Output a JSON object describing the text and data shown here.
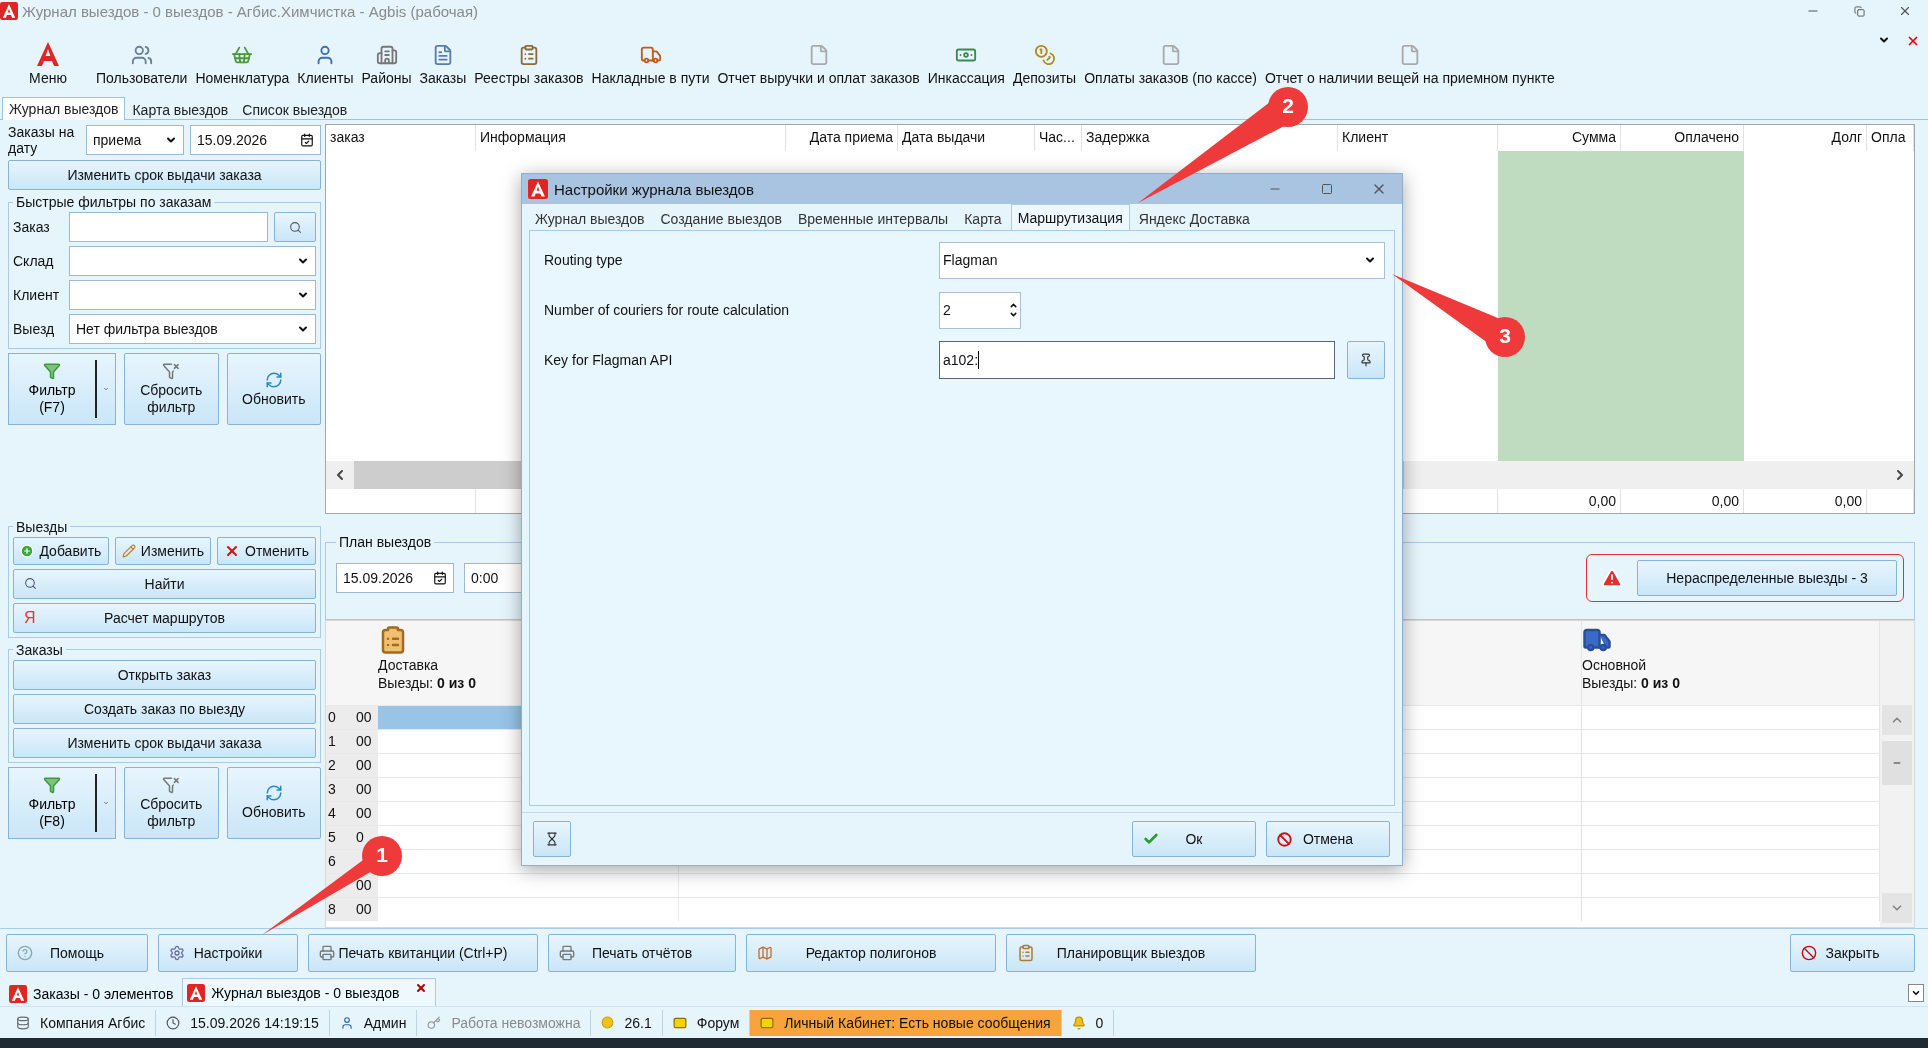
{
  "window": {
    "title": "Журнал выездов - 0 выездов - Агбис.Химчистка - Agbis (рабочая)"
  },
  "toolbar": {
    "menu_label": "Меню",
    "items": [
      {
        "label": "Пользователи"
      },
      {
        "label": "Номенклатура"
      },
      {
        "label": "Клиенты"
      },
      {
        "label": "Районы"
      },
      {
        "label": "Заказы"
      },
      {
        "label": "Реестры заказов"
      },
      {
        "label": "Накладные в пути"
      },
      {
        "label": "Отчет выручки и оплат заказов"
      },
      {
        "label": "Инкассация"
      },
      {
        "label": "Депозиты"
      },
      {
        "label": "Оплаты заказов (по кассе)"
      },
      {
        "label": "Отчет о наличии вещей на приемном пункте"
      }
    ]
  },
  "view_tabs": [
    {
      "label": "Журнал выездов",
      "selected": true
    },
    {
      "label": "Карта выездов",
      "selected": false
    },
    {
      "label": "Список выездов",
      "selected": false
    }
  ],
  "left_panel": {
    "date_filter": {
      "label": "Заказы на дату",
      "mode": "приема",
      "date": "15.09.2026"
    },
    "change_due_button": "Изменить срок выдачи заказа",
    "quick_filters": {
      "title": "Быстрые фильтры по заказам",
      "fields": [
        {
          "label": "Заказ",
          "kind": "search"
        },
        {
          "label": "Склад",
          "kind": "select"
        },
        {
          "label": "Клиент",
          "kind": "select"
        },
        {
          "label": "Выезд",
          "kind": "select",
          "value": "Нет фильтра выездов"
        }
      ]
    },
    "filter_buttons": [
      {
        "label": "Фильтр (F7)",
        "kind": "filter"
      },
      {
        "label": "Сбросить фильтр",
        "kind": "reset"
      },
      {
        "label": "Обновить",
        "kind": "refresh"
      }
    ],
    "trips": {
      "title": "Выезды",
      "actions": [
        {
          "label": "Добавить",
          "kind": "add"
        },
        {
          "label": "Изменить",
          "kind": "edit"
        },
        {
          "label": "Отменить",
          "kind": "cancel"
        }
      ],
      "find_button": "Найти",
      "route_button": {
        "icon": "Я",
        "label": "Расчет маршрутов"
      }
    },
    "orders": {
      "title": "Заказы",
      "buttons": [
        "Открыть заказ",
        "Создать заказ по выезду",
        "Изменить срок выдачи заказа"
      ]
    },
    "filter_buttons_2": [
      {
        "label": "Фильтр (F8)",
        "kind": "filter"
      },
      {
        "label": "Сбросить фильтр",
        "kind": "reset"
      },
      {
        "label": "Обновить",
        "kind": "refresh"
      }
    ]
  },
  "orders_table": {
    "columns": [
      {
        "label": "заказ",
        "highlighted": false
      },
      {
        "label": "Информация",
        "highlighted": false
      },
      {
        "label": "Дата приема",
        "highlighted": false
      },
      {
        "label": "Дата выдачи",
        "highlighted": false
      },
      {
        "label": "Час...",
        "highlighted": false
      },
      {
        "label": "Задержка",
        "highlighted": false
      },
      {
        "label": "Клиент",
        "highlighted": false
      },
      {
        "label": "Сумма",
        "highlighted": true,
        "total": "0,00"
      },
      {
        "label": "Оплачено",
        "highlighted": true,
        "total": "0,00"
      },
      {
        "label": "Долг",
        "highlighted": false,
        "total": "0,00"
      },
      {
        "label": "Опла",
        "highlighted": false
      }
    ]
  },
  "plan": {
    "title": "План выездов",
    "date": "15.09.2026",
    "time": "0:00",
    "alert_button": "Нераспределенные выезды - 3"
  },
  "schedule": {
    "columns": [
      {
        "name": "Доставка",
        "kind": "clipboard",
        "trips": "Выезды: **0 из 0**"
      },
      {
        "name": "Основной",
        "kind": "van",
        "trips": "Выезды: **0 из 0**"
      }
    ],
    "rows": [
      {
        "hour": "0",
        "minute": "00",
        "selected": true
      },
      {
        "hour": "1",
        "minute": "00",
        "selected": false
      },
      {
        "hour": "2",
        "minute": "00",
        "selected": false
      },
      {
        "hour": "3",
        "minute": "00",
        "selected": false
      },
      {
        "hour": "4",
        "minute": "00",
        "selected": false
      },
      {
        "hour": "5",
        "minute": "0",
        "selected": false
      },
      {
        "hour": "6",
        "selected": false
      },
      {
        "minute": "00",
        "selected": false
      },
      {
        "hour": "8",
        "minute": "00",
        "selected": false
      }
    ]
  },
  "bottom_buttons": [
    {
      "label": "Помощь",
      "kind": "help"
    },
    {
      "label": "Настройки",
      "kind": "settings"
    },
    {
      "label": "Печать квитанции (Ctrl+P)",
      "kind": "print"
    },
    {
      "label": "Печать отчётов",
      "kind": "print"
    },
    {
      "label": "Редактор полигонов",
      "kind": "map"
    },
    {
      "label": "Планировщик выездов",
      "kind": "planner"
    },
    {
      "label": "Закрыть",
      "kind": "close"
    }
  ],
  "doc_tabs": [
    {
      "label": "Заказы - 0 элементов",
      "selected": false,
      "closable": false
    },
    {
      "label": "Журнал выездов - 0 выездов",
      "selected": true,
      "closable": true
    }
  ],
  "status_bar": [
    {
      "text": "Компания Агбис",
      "kind": "company",
      "disabled": false,
      "highlighted": false
    },
    {
      "text": "15.09.2026 14:19:15",
      "kind": "clock",
      "disabled": false,
      "highlighted": false
    },
    {
      "text": "Админ",
      "kind": "user",
      "disabled": false,
      "highlighted": false
    },
    {
      "text": "Работа невозможна",
      "kind": "key",
      "disabled": true,
      "highlighted": false
    },
    {
      "text": "26.1",
      "kind": "version",
      "disabled": false,
      "highlighted": false
    },
    {
      "text": "Форум",
      "kind": "mail",
      "disabled": false,
      "highlighted": false
    },
    {
      "text": "Личный Кабинет: Есть новые сообщения",
      "kind": "mail",
      "disabled": false,
      "highlighted": true
    },
    {
      "text": "0",
      "kind": "bell",
      "disabled": false,
      "highlighted": false
    }
  ],
  "dialog": {
    "title": "Настройки журнала выездов",
    "tabs": [
      {
        "label": "Журнал выездов",
        "selected": false
      },
      {
        "label": "Создание выездов",
        "selected": false
      },
      {
        "label": "Временные интервалы",
        "selected": false
      },
      {
        "label": "Карта",
        "selected": false
      },
      {
        "label": "Маршрутизация",
        "selected": true
      },
      {
        "label": "Яндекс Доставка",
        "selected": false
      }
    ],
    "fields": [
      {
        "label": "Routing type",
        "kind": "select",
        "value": "Flagman"
      },
      {
        "label": "Number of couriers for route calculation",
        "kind": "spinner",
        "value": "2"
      },
      {
        "label": "Key for Flagman API",
        "kind": "key",
        "value": "a102:"
      }
    ],
    "buttons": [
      {
        "label": "Ок",
        "kind": "ok"
      },
      {
        "label": "Отмена",
        "kind": "cancel"
      }
    ]
  },
  "annotations": [
    {
      "number": "1"
    },
    {
      "number": "2"
    },
    {
      "number": "3"
    }
  ]
}
